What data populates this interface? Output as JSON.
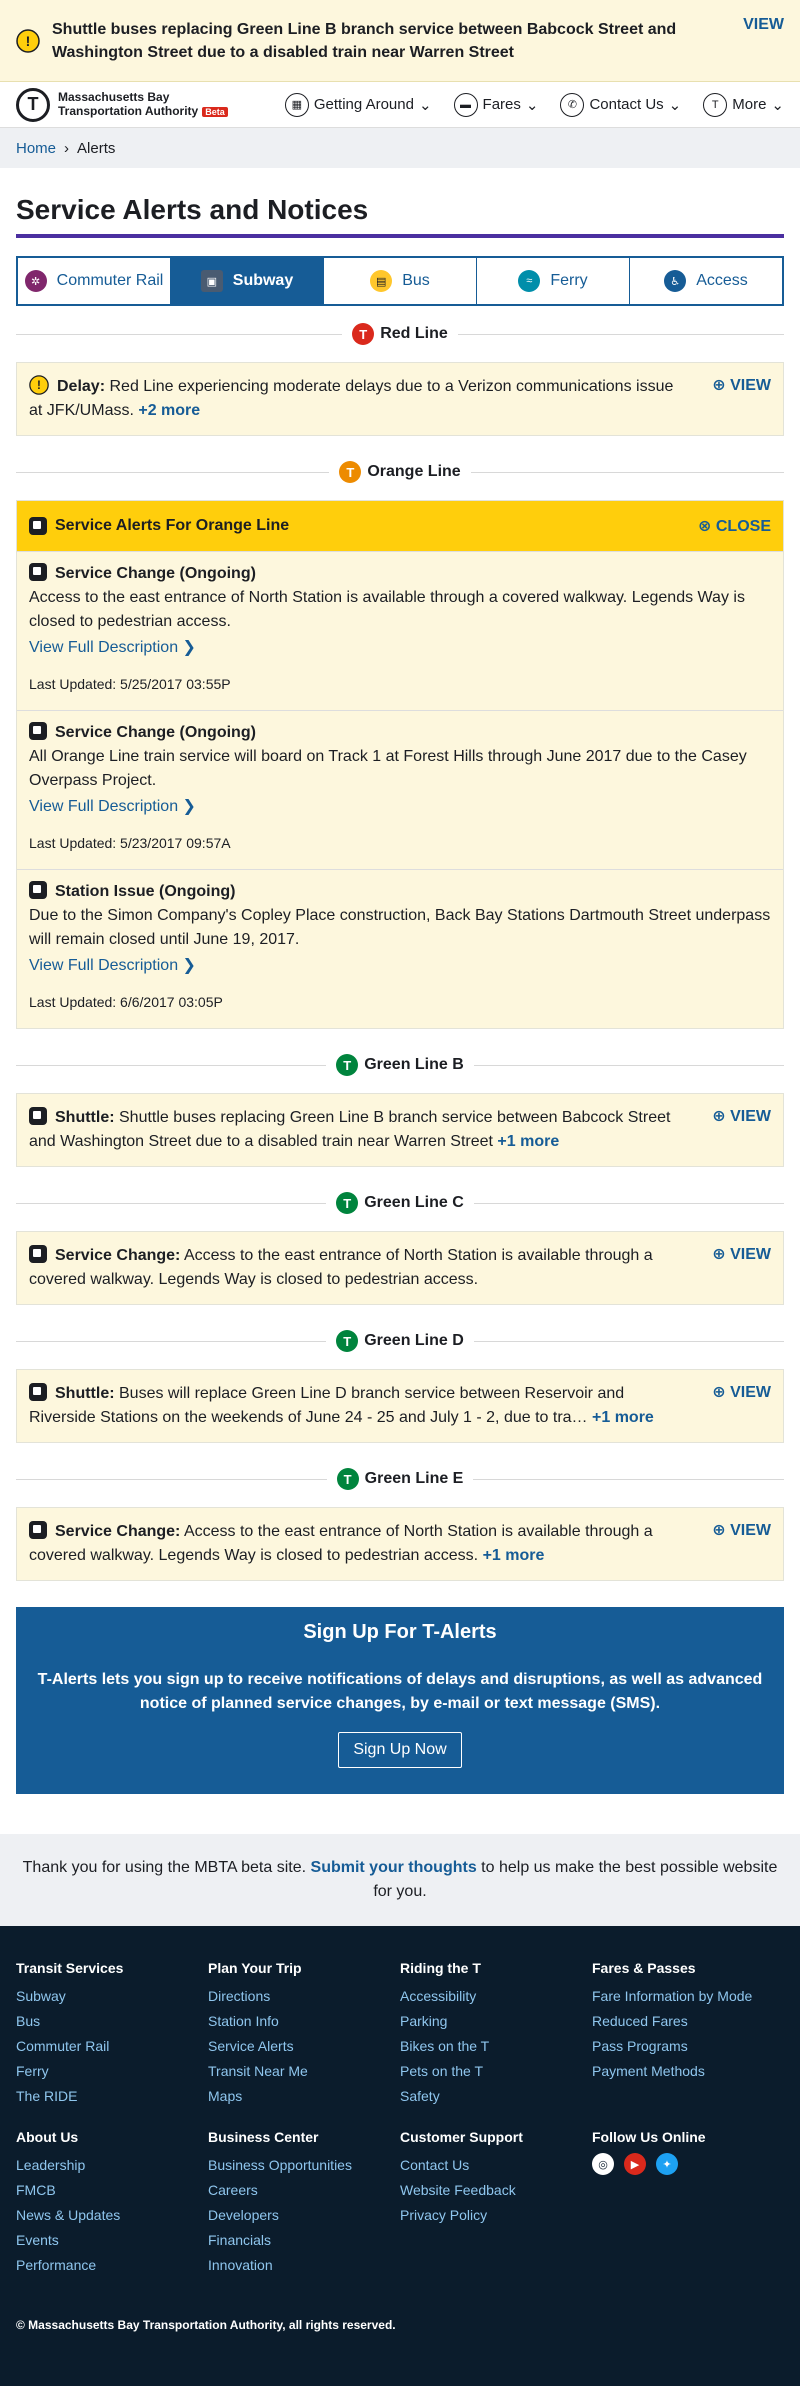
{
  "banner": {
    "message": "Shuttle buses replacing Green Line B branch service between Babcock Street and Washington Street due to a disabled train near Warren Street",
    "view": "VIEW"
  },
  "header": {
    "logo_line1": "Massachusetts Bay",
    "logo_line2": "Transportation Authority",
    "beta": "Beta",
    "nav": [
      "Getting Around",
      "Fares",
      "Contact Us",
      "More"
    ]
  },
  "breadcrumb": {
    "home": "Home",
    "current": "Alerts"
  },
  "page_title": "Service Alerts and Notices",
  "modes": [
    "Commuter Rail",
    "Subway",
    "Bus",
    "Ferry",
    "Access"
  ],
  "red_line": {
    "title": "Red Line",
    "label": "Delay:",
    "text": "Red Line experiencing moderate delays due to a Verizon communications issue at JFK/UMass.",
    "more": "+2 more",
    "view": "VIEW"
  },
  "orange_line": {
    "title": "Orange Line",
    "header": "Service Alerts For Orange Line",
    "close": "CLOSE",
    "items": [
      {
        "title": "Service Change (Ongoing)",
        "text": "Access to the east entrance of North Station is available through a covered walkway. Legends Way is closed to pedestrian access.",
        "link": "View Full Description",
        "updated": "Last Updated: 5/25/2017 03:55P"
      },
      {
        "title": "Service Change (Ongoing)",
        "text": "All Orange Line train service will board on Track 1 at Forest Hills through June 2017 due to the Casey Overpass Project.",
        "link": "View Full Description",
        "updated": "Last Updated: 5/23/2017 09:57A"
      },
      {
        "title": "Station Issue (Ongoing)",
        "text": "Due to the Simon Company's Copley Place construction, Back Bay Stations Dartmouth Street underpass will remain closed until June 19, 2017.",
        "link": "View Full Description",
        "updated": "Last Updated: 6/6/2017 03:05P"
      }
    ]
  },
  "green_b": {
    "title": "Green Line B",
    "label": "Shuttle:",
    "text": "Shuttle buses replacing Green Line B branch service between Babcock Street and Washington Street due to a disabled train near Warren Street",
    "more": "+1 more",
    "view": "VIEW"
  },
  "green_c": {
    "title": "Green Line C",
    "label": "Service Change:",
    "text": "Access to the east entrance of North Station is available through a covered walkway. Legends Way is closed to pedestrian access.",
    "view": "VIEW"
  },
  "green_d": {
    "title": "Green Line D",
    "label": "Shuttle:",
    "text": "Buses will replace Green Line D branch service between Reservoir and Riverside Stations on the weekends of June 24 - 25 and July 1 - 2, due to tra…",
    "more": "+1 more",
    "view": "VIEW"
  },
  "green_e": {
    "title": "Green Line E",
    "label": "Service Change:",
    "text": "Access to the east entrance of North Station is available through a covered walkway. Legends Way is closed to pedestrian access.",
    "more": "+1 more",
    "view": "VIEW"
  },
  "signup": {
    "title": "Sign Up For T-Alerts",
    "text": "T-Alerts lets you sign up to receive notifications of delays and disruptions, as well as advanced notice of planned service changes, by e-mail or text message (SMS).",
    "button": "Sign Up Now"
  },
  "feedback": {
    "before": "Thank you for using the MBTA beta site.",
    "link": "Submit your thoughts",
    "after": "to help us make the best possible website for you."
  },
  "footer": {
    "transit": {
      "title": "Transit Services",
      "links": [
        "Subway",
        "Bus",
        "Commuter Rail",
        "Ferry",
        "The RIDE"
      ]
    },
    "plan": {
      "title": "Plan Your Trip",
      "links": [
        "Directions",
        "Station Info",
        "Service Alerts",
        "Transit Near Me",
        "Maps"
      ]
    },
    "riding": {
      "title": "Riding the T",
      "links": [
        "Accessibility",
        "Parking",
        "Bikes on the T",
        "Pets on the T",
        "Safety"
      ]
    },
    "fares": {
      "title": "Fares & Passes",
      "links": [
        "Fare Information by Mode",
        "Reduced Fares",
        "Pass Programs",
        "Payment Methods"
      ]
    },
    "about": {
      "title": "About Us",
      "links": [
        "Leadership",
        "FMCB",
        "News & Updates",
        "Events",
        "Performance"
      ]
    },
    "business": {
      "title": "Business Center",
      "links": [
        "Business Opportunities",
        "Careers",
        "Developers",
        "Financials",
        "Innovation"
      ]
    },
    "support": {
      "title": "Customer Support",
      "links": [
        "Contact Us",
        "Website Feedback",
        "Privacy Policy"
      ]
    },
    "follow": {
      "title": "Follow Us Online"
    },
    "copyright": "© Massachusetts Bay Transportation Authority, all rights reserved."
  },
  "colors": {
    "primary": "#165c96",
    "red": "#da291c",
    "orange": "#ed8b00",
    "green": "#00843d",
    "alert_bg": "#fdf7dd",
    "yellow": "#ffce0c",
    "footer": "#0b1c2c"
  }
}
